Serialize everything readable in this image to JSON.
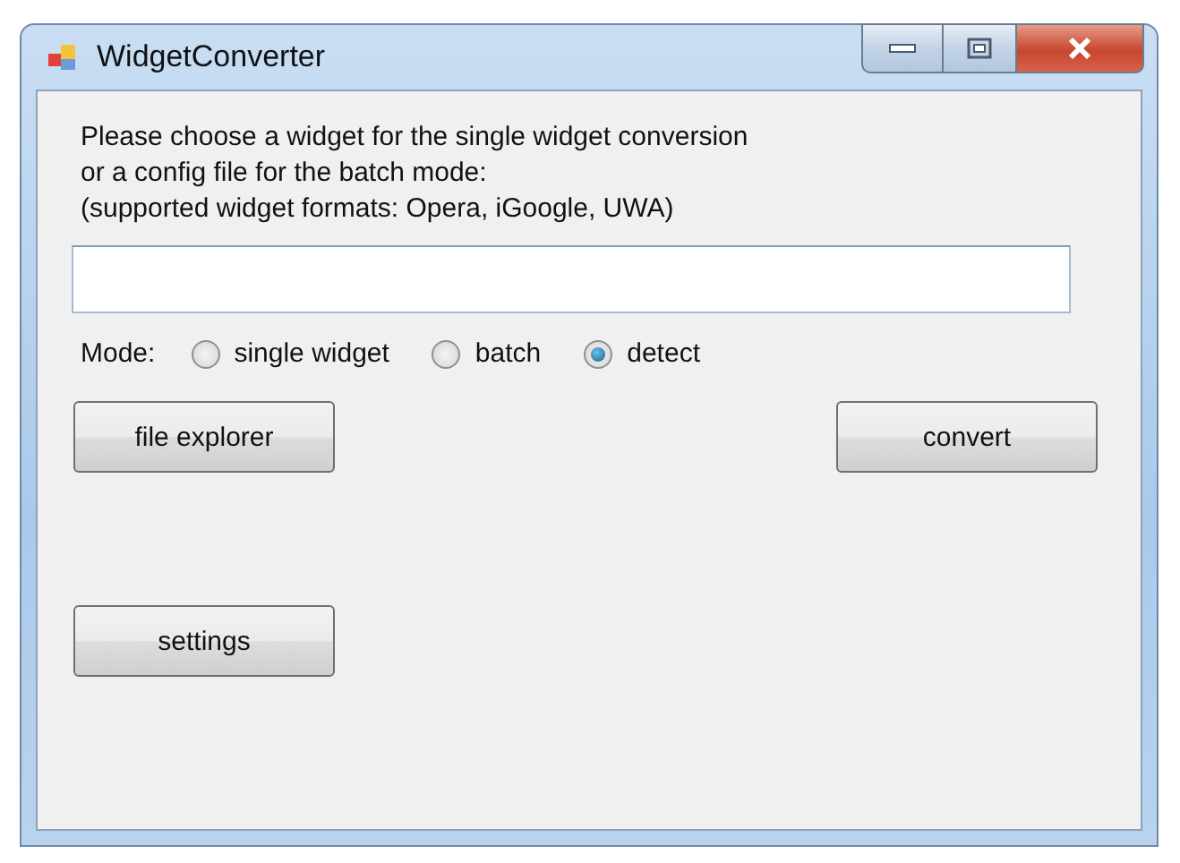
{
  "window": {
    "title": "WidgetConverter"
  },
  "instructions": [
    "Please choose a widget for the single widget conversion",
    "or a config file for the batch mode:",
    "(supported widget formats: Opera, iGoogle, UWA)"
  ],
  "mode": {
    "label": "Mode:",
    "options": [
      {
        "label": "single widget",
        "selected": false
      },
      {
        "label": "batch",
        "selected": false
      },
      {
        "label": "detect",
        "selected": true
      }
    ]
  },
  "buttons": {
    "file_explorer": "file explorer",
    "convert": "convert",
    "settings": "settings"
  }
}
